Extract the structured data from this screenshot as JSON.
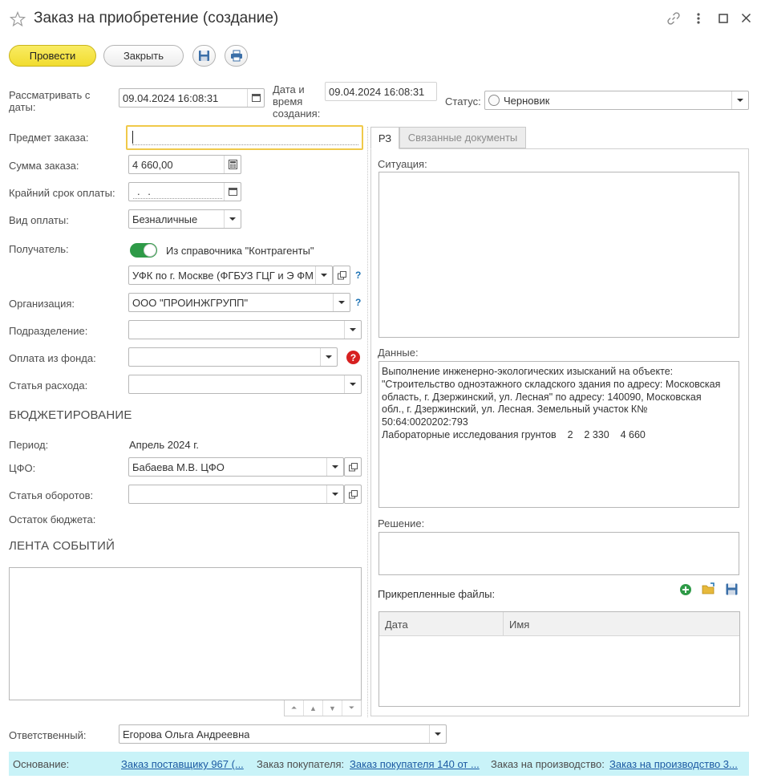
{
  "window": {
    "title": "Заказ на приобретение (создание)",
    "icons": [
      "star-icon",
      "link-icon",
      "more-icon",
      "maximize-icon",
      "close-icon"
    ]
  },
  "toolbar": {
    "post_label": "Провести",
    "close_label": "Закрыть",
    "icons": [
      "save-icon",
      "print-icon"
    ]
  },
  "header": {
    "review_label": "Рассматривать с\nдаты:",
    "review_value": "09.04.2024 16:08:31",
    "created_label": "Дата и\nвремя\nсоздания:",
    "created_value": "09.04.2024 16:08:31",
    "status_label": "Статус:",
    "status_value": "Черновик"
  },
  "left": {
    "subject_label": "Предмет заказа:",
    "subject_value": "",
    "sum_label": "Сумма заказа:",
    "sum_value": "4 660,00",
    "deadline_label": "Крайний срок оплаты:",
    "deadline_value": " .  .",
    "paytype_label": "Вид оплаты:",
    "paytype_value": "Безналичные",
    "recipient_label": "Получатель:",
    "recipient_toggle_label": "Из справочника \"Контрагенты\"",
    "recipient_toggle_on": true,
    "recipient_value": "УФК по г. Москве (ФГБУЗ ГЦГ и Э ФМ",
    "org_label": "Организация:",
    "org_value": "ООО \"ПРОИНЖГРУПП\"",
    "division_label": "Подразделение:",
    "division_value": "",
    "fund_label": "Оплата из фонда:",
    "fund_value": "",
    "expense_label": "Статья расхода:",
    "expense_value": "",
    "help_mark": "?"
  },
  "budget": {
    "title": "БЮДЖЕТИРОВАНИЕ",
    "period_label": "Период:",
    "period_value": "Апрель 2024 г.",
    "cfo_label": "ЦФО:",
    "cfo_value": "Бабаева М.В. ЦФО",
    "turnover_label": "Статья оборотов:",
    "turnover_value": "",
    "remainder_label": "Остаток бюджета:"
  },
  "events": {
    "title": "ЛЕНТА СОБЫТИЙ"
  },
  "tabs": [
    {
      "label": "РЗ",
      "active": true
    },
    {
      "label": "Связанные документы",
      "active": false
    }
  ],
  "rz": {
    "situation_label": "Ситуация:",
    "situation_value": "",
    "data_label": "Данные:",
    "data_lines": [
      "Выполнение инженерно-экологических изысканий на объекте:",
      "\"Строительство одноэтажного складского здания по адресу: Московская",
      "область, г. Дзержинский, ул. Лесная\" по адресу: 140090, Московская",
      "обл., г. Дзержинский, ул. Лесная. Земельный участок К№",
      "50:64:0020202:793",
      "Лабораторные исследования грунтов    2    2 330    4 660"
    ],
    "decision_label": "Решение:",
    "decision_value": "",
    "files_label": "Прикрепленные файлы:",
    "files_columns": [
      "Дата",
      "Имя"
    ],
    "file_icons": [
      "add-file-icon",
      "open-folder-icon",
      "save-file-icon"
    ]
  },
  "footer": {
    "responsible_label": "Ответственный:",
    "responsible_value": "Егорова Ольга Андреевна",
    "basis_label": "Основание:",
    "basis_link1": "Заказ поставщику 967 (...",
    "buyer_label": "Заказ покупателя:",
    "buyer_link": "Заказ покупателя 140 от ...",
    "production_label": "Заказ на производство:",
    "production_link": "Заказ на производство 3..."
  },
  "colors": {
    "accent_yellow": "#f5e44c",
    "footer_bg": "#c9f3f8",
    "link": "#1b5aa3",
    "toggle_green": "#2e9a47",
    "help_red": "#d72020"
  }
}
